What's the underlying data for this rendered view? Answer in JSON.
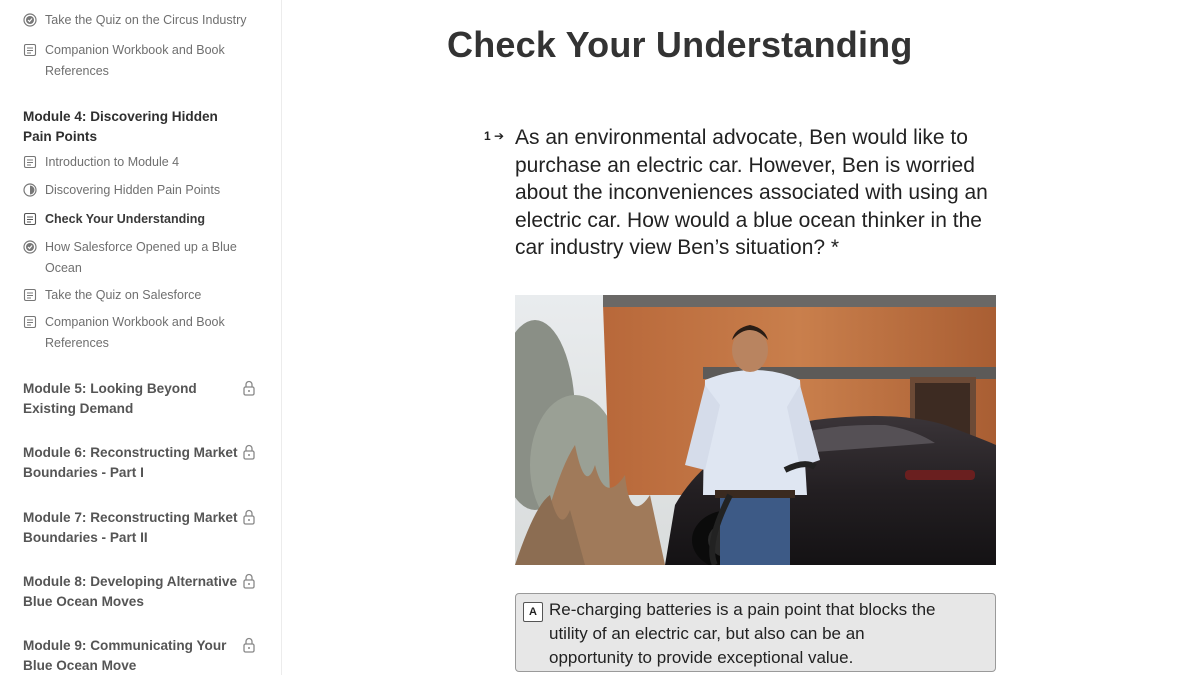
{
  "sidebar": {
    "top_items": [
      {
        "label": "Take the Quiz on the Circus Industry",
        "icon": "check-circle-icon"
      },
      {
        "label": "Companion Workbook and Book References",
        "icon": "document-icon"
      }
    ],
    "module4": {
      "title": "Module 4: Discovering Hidden Pain Points",
      "items": [
        {
          "label": "Introduction to Module 4",
          "icon": "document-icon"
        },
        {
          "label": "Discovering Hidden Pain Points",
          "icon": "half-circle-icon"
        },
        {
          "label": "Check Your Understanding",
          "icon": "document-icon",
          "active": true
        },
        {
          "label": "How Salesforce Opened up a Blue Ocean",
          "icon": "check-circle-icon"
        },
        {
          "label": "Take the Quiz on Salesforce",
          "icon": "document-icon"
        },
        {
          "label": "Companion Workbook and Book References",
          "icon": "document-icon"
        }
      ]
    },
    "locked_modules": [
      {
        "title": "Module 5: Looking Beyond Existing Demand"
      },
      {
        "title": "Module 6: Reconstructing Market Boundaries - Part I"
      },
      {
        "title": "Module 7: Reconstructing Market Boundaries - Part II"
      },
      {
        "title": "Module 8: Developing Alternative Blue Ocean Moves"
      },
      {
        "title": "Module 9: Communicating Your Blue Ocean Move"
      }
    ]
  },
  "main": {
    "title": "Check Your Understanding",
    "question": {
      "number": "1",
      "arrow": "➔",
      "text": "As an environmental advocate, Ben would like to purchase an electric car. However, Ben is worried about the inconveniences associated with using an electric car. How would a blue ocean thinker in the car industry view Ben’s situation? *"
    },
    "options": [
      {
        "key": "A",
        "text": "Re-charging batteries is a pain point that blocks the utility of an electric car, but also can be an opportunity to provide exceptional value."
      }
    ]
  },
  "colors": {
    "sidebar_text": "#6f6f6f",
    "module_title": "#555555",
    "option_bg": "#e7e7e7",
    "option_border": "#9a9a9a"
  }
}
